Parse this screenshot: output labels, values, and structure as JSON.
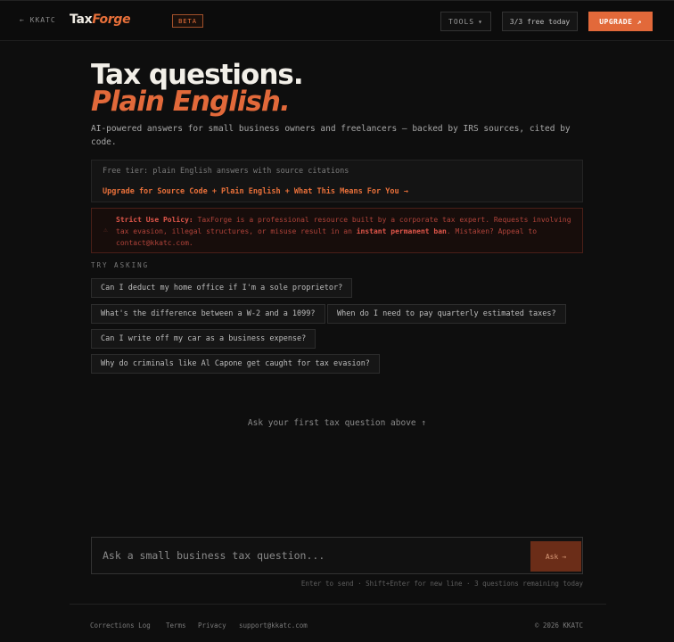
{
  "header": {
    "back_label": "← KKATC",
    "logo_part1": "Tax",
    "logo_part2": "Forge",
    "beta_label": "BETA",
    "tools_label": "TOOLS",
    "tools_caret": "▾",
    "free_count": "3/3 free today",
    "upgrade_label": "UPGRADE",
    "upgrade_icon": "↗"
  },
  "hero": {
    "title": "Tax questions.",
    "subtitle": "Plain English.",
    "description": "AI-powered answers for small business owners and freelancers — backed by IRS sources, cited by code."
  },
  "tier": {
    "label": "Free tier: plain English answers with source citations",
    "upgrade_link": "Upgrade for Source Code + Plain English + What This Means For You →"
  },
  "policy": {
    "icon": "⚠",
    "heading": "Strict Use Policy:",
    "text_a": " TaxForge is a professional resource built by a corporate tax expert. Requests involving tax evasion, illegal structures, or misuse result in an ",
    "emphasis": "instant permanent ban",
    "text_b": ". Mistaken? Appeal to contact@kkatc.com."
  },
  "suggestions": {
    "label": "TRY ASKING",
    "items": [
      "Can I deduct my home office if I'm a sole proprietor?",
      "What's the difference between a W-2 and a 1099?",
      "When do I need to pay quarterly estimated taxes?",
      "Can I write off my car as a business expense?",
      "Why do criminals like Al Capone get caught for tax evasion?"
    ]
  },
  "empty_state": "Ask your first tax question above ↑",
  "ask": {
    "placeholder": "Ask a small business tax question...",
    "button_label": "Ask",
    "button_icon": "→",
    "hint": "Enter to send · Shift+Enter for new line · 3 questions remaining today"
  },
  "footer": {
    "links": [
      "Corrections Log",
      "Terms",
      "Privacy",
      "support@kkatc.com"
    ],
    "copyright": "© 2026 KKATC"
  },
  "colors": {
    "accent": "#e2693a",
    "background": "#0e0e0e",
    "danger": "#e0564a"
  }
}
